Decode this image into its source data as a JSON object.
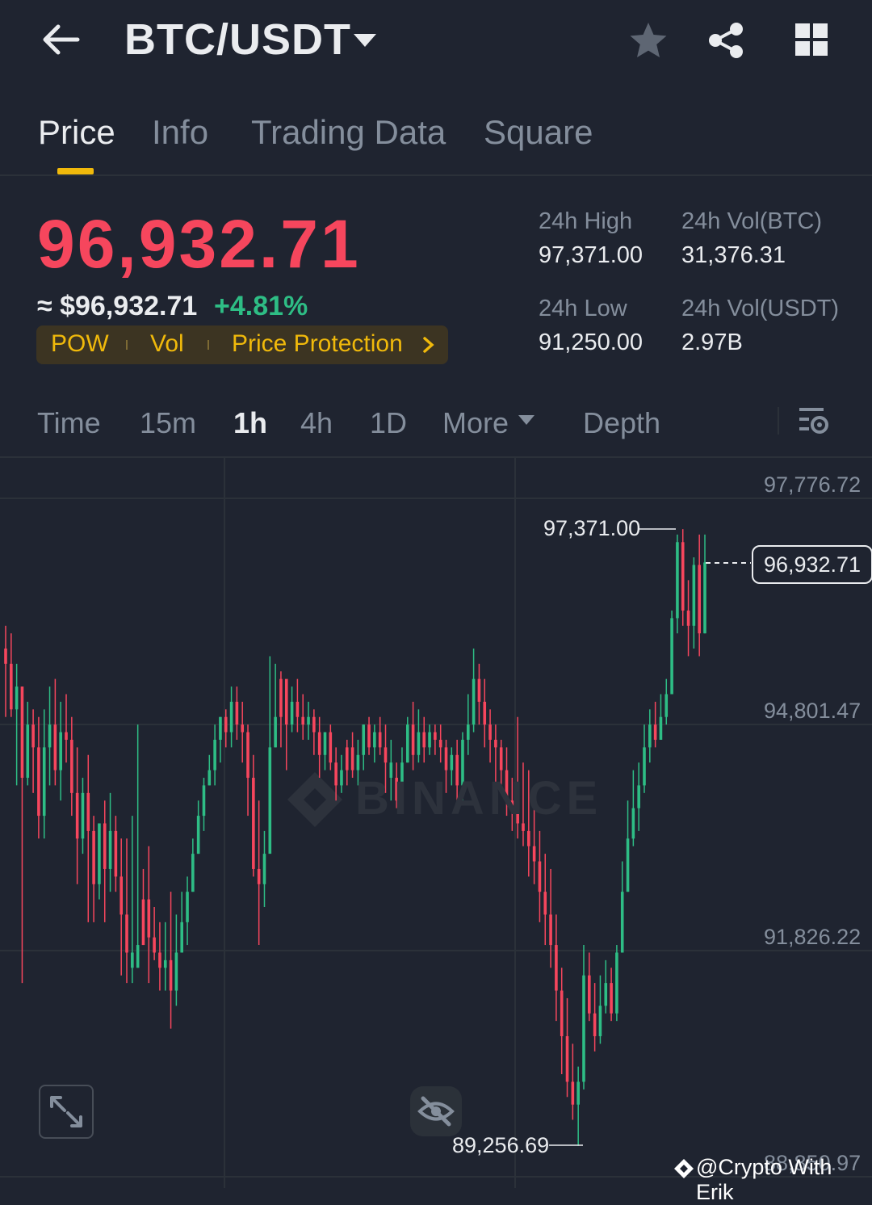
{
  "header": {
    "pair": "BTC/USDT",
    "icons": [
      "back-arrow-icon",
      "star-icon",
      "share-icon",
      "grid-icon"
    ]
  },
  "tabs": [
    {
      "label": "Price",
      "active": true
    },
    {
      "label": "Info"
    },
    {
      "label": "Trading Data"
    },
    {
      "label": "Square"
    }
  ],
  "price": {
    "last": "96,932.71",
    "fiat": "≈ $96,932.71",
    "change": "+4.81%",
    "tags": [
      "POW",
      "Vol",
      "Price Protection"
    ]
  },
  "stats": {
    "high_label": "24h High",
    "high_value": "97,371.00",
    "low_label": "24h Low",
    "low_value": "91,250.00",
    "vol_btc_label": "24h Vol(BTC)",
    "vol_btc_value": "31,376.31",
    "vol_usdt_label": "24h Vol(USDT)",
    "vol_usdt_value": "2.97B"
  },
  "timeframes": [
    "Time",
    "15m",
    "1h",
    "4h",
    "1D",
    "More",
    "Depth"
  ],
  "active_timeframe": "1h",
  "chart": {
    "axis_labels": [
      "97,776.72",
      "94,801.47",
      "91,826.22",
      "88,850.97"
    ],
    "high_marker": "97,371.00",
    "low_marker": "89,256.69",
    "current_price": "96,932.71",
    "watermark": "BINANCE",
    "credit": "@Crypto With Erik",
    "colors": {
      "up": "#2ebd85",
      "down": "#f6465d",
      "accent": "#f0b90b"
    }
  },
  "chart_data": {
    "type": "candlestick",
    "y_ticks": [
      97776.72,
      94801.47,
      91826.22,
      88850.97
    ],
    "candles": [
      [
        95800,
        95600,
        94900,
        96100,
        "d"
      ],
      [
        95600,
        95000,
        94900,
        96000,
        "d"
      ],
      [
        95000,
        95300,
        94000,
        95600,
        "u"
      ],
      [
        95300,
        94100,
        91400,
        95300,
        "d"
      ],
      [
        94100,
        94800,
        94000,
        95100,
        "u"
      ],
      [
        94800,
        94500,
        93900,
        95000,
        "d"
      ],
      [
        94500,
        93600,
        93300,
        94900,
        "d"
      ],
      [
        93600,
        94500,
        93300,
        95000,
        "u"
      ],
      [
        94500,
        94800,
        94000,
        95300,
        "u"
      ],
      [
        94800,
        94200,
        94000,
        95400,
        "d"
      ],
      [
        94200,
        94700,
        93800,
        95100,
        "u"
      ],
      [
        94700,
        94600,
        94300,
        95200,
        "d"
      ],
      [
        94600,
        93900,
        93600,
        94900,
        "d"
      ],
      [
        93900,
        93300,
        92700,
        94500,
        "d"
      ],
      [
        93300,
        93900,
        93100,
        94100,
        "u"
      ],
      [
        93900,
        93400,
        92200,
        94400,
        "d"
      ],
      [
        93400,
        92700,
        92200,
        93600,
        "d"
      ],
      [
        92700,
        93500,
        92500,
        93500,
        "u"
      ],
      [
        93500,
        92900,
        92200,
        93800,
        "d"
      ],
      [
        92900,
        93400,
        92600,
        93900,
        "u"
      ],
      [
        93400,
        92800,
        92600,
        93600,
        "d"
      ],
      [
        92800,
        92300,
        91500,
        93300,
        "d"
      ],
      [
        92300,
        91800,
        91400,
        93300,
        "d"
      ],
      [
        91800,
        91600,
        91400,
        93600,
        "u"
      ],
      [
        91600,
        91900,
        91600,
        94800,
        "u"
      ],
      [
        91900,
        92500,
        91900,
        92900,
        "d"
      ],
      [
        92500,
        92000,
        91400,
        93200,
        "d"
      ],
      [
        92000,
        91800,
        91700,
        92400,
        "d"
      ],
      [
        91800,
        91600,
        91300,
        92200,
        "d"
      ],
      [
        91600,
        91700,
        91300,
        92200,
        "u"
      ],
      [
        91700,
        91300,
        90800,
        92600,
        "d"
      ],
      [
        91300,
        91800,
        91100,
        92300,
        "u"
      ],
      [
        91800,
        92200,
        91900,
        92600,
        "u"
      ],
      [
        92200,
        92600,
        91900,
        92800,
        "u"
      ],
      [
        92600,
        93100,
        92600,
        93300,
        "u"
      ],
      [
        93100,
        93600,
        93100,
        93800,
        "u"
      ],
      [
        93600,
        94000,
        93400,
        94100,
        "u"
      ],
      [
        94000,
        94200,
        94000,
        94400,
        "u"
      ],
      [
        94200,
        94600,
        94000,
        94800,
        "u"
      ],
      [
        94600,
        94900,
        94300,
        94900,
        "u"
      ],
      [
        94900,
        94700,
        94500,
        95000,
        "d"
      ],
      [
        94700,
        95100,
        94500,
        95300,
        "u"
      ],
      [
        95100,
        94800,
        94600,
        95300,
        "d"
      ],
      [
        94800,
        94700,
        94300,
        95100,
        "d"
      ],
      [
        94700,
        94100,
        93600,
        94800,
        "d"
      ],
      [
        94100,
        92900,
        92800,
        94400,
        "d"
      ],
      [
        92900,
        92700,
        91900,
        93800,
        "d"
      ],
      [
        92700,
        93100,
        92400,
        93400,
        "u"
      ],
      [
        93100,
        94500,
        93200,
        95700,
        "u"
      ],
      [
        94500,
        94900,
        94500,
        95600,
        "u"
      ],
      [
        94900,
        95400,
        94500,
        95500,
        "d"
      ],
      [
        95400,
        94800,
        94200,
        95300,
        "d"
      ],
      [
        94800,
        95100,
        94700,
        95300,
        "u"
      ],
      [
        95100,
        94900,
        94700,
        95400,
        "d"
      ],
      [
        94900,
        94800,
        94600,
        95200,
        "d"
      ],
      [
        94800,
        94900,
        94600,
        95100,
        "u"
      ],
      [
        94900,
        94700,
        94400,
        95000,
        "d"
      ],
      [
        94700,
        94400,
        94100,
        94900,
        "d"
      ],
      [
        94400,
        94700,
        94200,
        94700,
        "u"
      ],
      [
        94700,
        94300,
        94200,
        94800,
        "d"
      ],
      [
        94300,
        94000,
        93800,
        94500,
        "d"
      ],
      [
        94000,
        94200,
        93900,
        94400,
        "u"
      ],
      [
        94200,
        94500,
        94000,
        94600,
        "d"
      ],
      [
        94500,
        94200,
        94100,
        94700,
        "d"
      ],
      [
        94200,
        94400,
        94000,
        94600,
        "u"
      ],
      [
        94400,
        94800,
        94200,
        94800,
        "u"
      ],
      [
        94800,
        94500,
        94400,
        94900,
        "d"
      ],
      [
        94500,
        94700,
        94300,
        94800,
        "u"
      ],
      [
        94700,
        94500,
        94400,
        94900,
        "d"
      ],
      [
        94500,
        94300,
        93900,
        94800,
        "d"
      ],
      [
        94300,
        94100,
        93800,
        94600,
        "u"
      ],
      [
        94100,
        93800,
        93700,
        94300,
        "d"
      ],
      [
        93800,
        94300,
        93700,
        94500,
        "u"
      ],
      [
        94300,
        94800,
        94300,
        94900,
        "u"
      ],
      [
        94800,
        94400,
        94200,
        95100,
        "d"
      ],
      [
        94400,
        94700,
        94300,
        95000,
        "u"
      ],
      [
        94700,
        94500,
        94300,
        94900,
        "d"
      ],
      [
        94500,
        94700,
        94400,
        94800,
        "u"
      ],
      [
        94700,
        94600,
        94400,
        94800,
        "d"
      ],
      [
        94600,
        94500,
        94300,
        94800,
        "d"
      ],
      [
        94500,
        94200,
        93900,
        94600,
        "d"
      ],
      [
        94200,
        94400,
        94000,
        94500,
        "u"
      ],
      [
        94400,
        94000,
        93800,
        94600,
        "d"
      ],
      [
        94000,
        94600,
        93800,
        94700,
        "u"
      ],
      [
        94600,
        94800,
        94400,
        95200,
        "u"
      ],
      [
        94800,
        95400,
        94700,
        95800,
        "u"
      ],
      [
        95400,
        95100,
        94800,
        95600,
        "d"
      ],
      [
        95100,
        94800,
        94500,
        95400,
        "d"
      ],
      [
        94800,
        94600,
        94300,
        95000,
        "d"
      ],
      [
        94600,
        94500,
        94000,
        94800,
        "d"
      ],
      [
        94500,
        94200,
        93900,
        94600,
        "d"
      ],
      [
        94200,
        93800,
        93600,
        94500,
        "d"
      ],
      [
        93800,
        93700,
        93400,
        94100,
        "d"
      ],
      [
        93700,
        93500,
        93300,
        94900,
        "d"
      ],
      [
        93500,
        93400,
        93200,
        94300,
        "d"
      ],
      [
        93400,
        93200,
        92800,
        94200,
        "d"
      ],
      [
        93200,
        93000,
        92700,
        93800,
        "d"
      ],
      [
        93000,
        92600,
        92200,
        93400,
        "d"
      ],
      [
        92600,
        92300,
        91900,
        93100,
        "d"
      ],
      [
        92300,
        91900,
        91600,
        92900,
        "d"
      ],
      [
        91900,
        91300,
        90900,
        92300,
        "d"
      ],
      [
        91300,
        90700,
        90200,
        91600,
        "d"
      ],
      [
        90700,
        90100,
        89900,
        91200,
        "d"
      ],
      [
        90100,
        89800,
        89600,
        90600,
        "d"
      ],
      [
        89800,
        90100,
        89256.69,
        90300,
        "u"
      ],
      [
        90100,
        91500,
        90000,
        91900,
        "u"
      ],
      [
        91500,
        91000,
        90900,
        91800,
        "d"
      ],
      [
        91000,
        90700,
        90500,
        91400,
        "d"
      ],
      [
        90700,
        91100,
        90600,
        91500,
        "u"
      ],
      [
        91100,
        91400,
        91000,
        91700,
        "u"
      ],
      [
        91400,
        91000,
        90900,
        91600,
        "d"
      ],
      [
        91000,
        91800,
        90900,
        91900,
        "u"
      ],
      [
        91800,
        92600,
        91800,
        93000,
        "u"
      ],
      [
        92600,
        93300,
        92600,
        93800,
        "u"
      ],
      [
        93300,
        93700,
        93200,
        94200,
        "u"
      ],
      [
        93700,
        94000,
        93400,
        94300,
        "u"
      ],
      [
        94000,
        94500,
        93900,
        94800,
        "u"
      ],
      [
        94500,
        94800,
        94300,
        95000,
        "u"
      ],
      [
        94800,
        94600,
        94500,
        95100,
        "d"
      ],
      [
        94600,
        94900,
        94600,
        95200,
        "u"
      ],
      [
        94900,
        95200,
        94800,
        95400,
        "u"
      ],
      [
        95200,
        96200,
        95200,
        96300,
        "u"
      ],
      [
        96200,
        97200,
        96000,
        97300,
        "u"
      ],
      [
        97200,
        96300,
        96100,
        97371,
        "d"
      ],
      [
        96300,
        96100,
        95700,
        96700,
        "d"
      ],
      [
        96100,
        96900,
        95800,
        97000,
        "u"
      ],
      [
        96900,
        96000,
        95700,
        97300,
        "d"
      ],
      [
        96000,
        96932.71,
        96000,
        97300,
        "u"
      ]
    ]
  }
}
